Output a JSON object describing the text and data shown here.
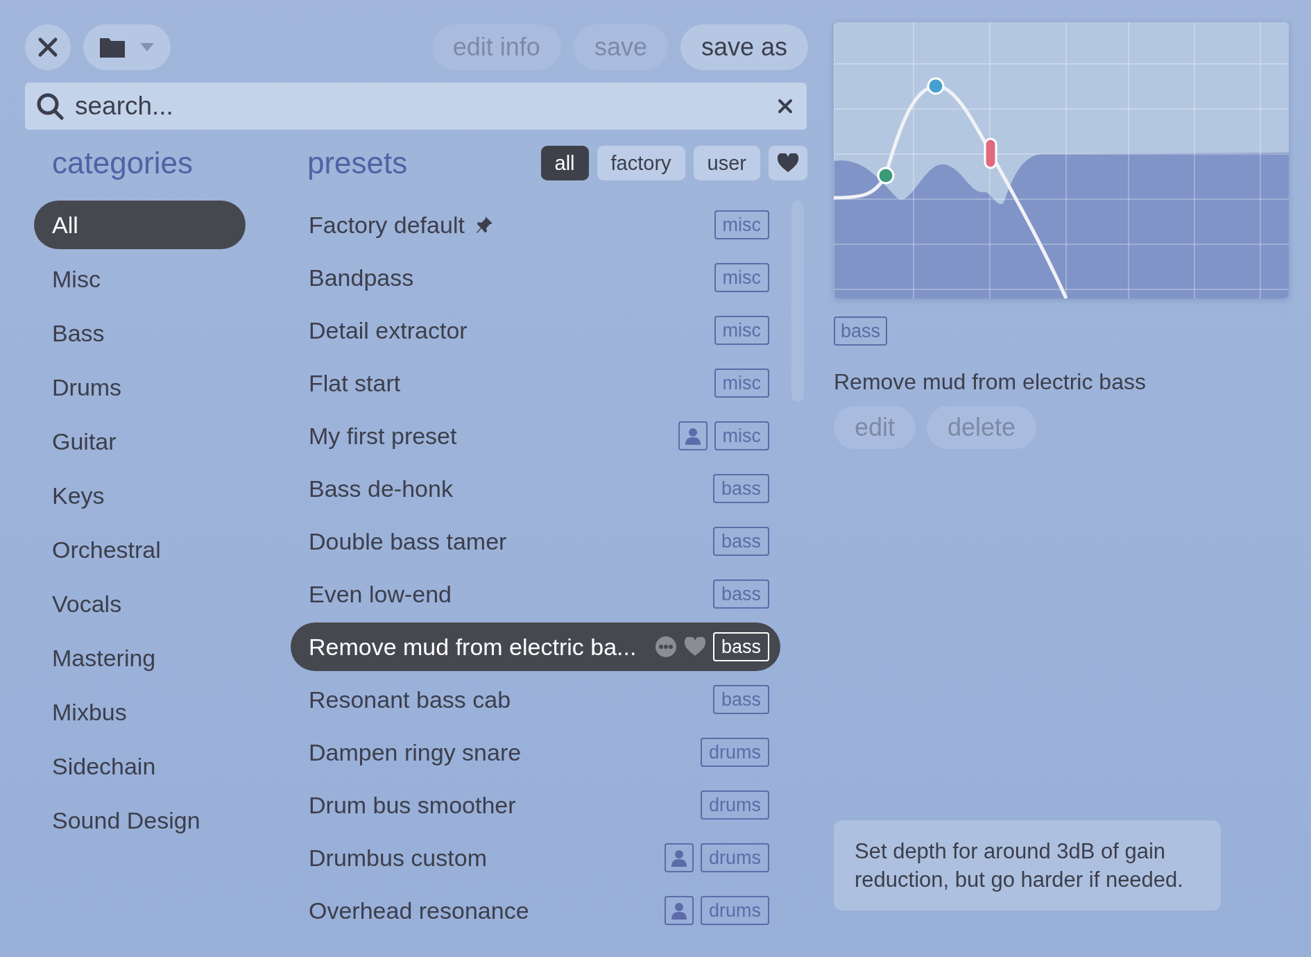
{
  "toolbar": {
    "buttons": [
      {
        "label": "edit info",
        "disabled": true
      },
      {
        "label": "save",
        "disabled": true
      },
      {
        "label": "save as",
        "disabled": false
      }
    ]
  },
  "search": {
    "placeholder": "search..."
  },
  "categories": {
    "title": "categories",
    "items": [
      {
        "label": "All",
        "selected": true
      },
      {
        "label": "Misc",
        "selected": false
      },
      {
        "label": "Bass",
        "selected": false
      },
      {
        "label": "Drums",
        "selected": false
      },
      {
        "label": "Guitar",
        "selected": false
      },
      {
        "label": "Keys",
        "selected": false
      },
      {
        "label": "Orchestral",
        "selected": false
      },
      {
        "label": "Vocals",
        "selected": false
      },
      {
        "label": "Mastering",
        "selected": false
      },
      {
        "label": "Mixbus",
        "selected": false
      },
      {
        "label": "Sidechain",
        "selected": false
      },
      {
        "label": "Sound Design",
        "selected": false
      }
    ]
  },
  "presets": {
    "title": "presets",
    "filters": [
      {
        "label": "all",
        "selected": true
      },
      {
        "label": "factory",
        "selected": false
      },
      {
        "label": "user",
        "selected": false
      },
      {
        "kind": "favorites",
        "selected": false
      }
    ],
    "items": [
      {
        "name": "Factory default",
        "tag": "misc",
        "pinned": true,
        "user": false,
        "selected": false
      },
      {
        "name": "Bandpass",
        "tag": "misc",
        "pinned": false,
        "user": false,
        "selected": false
      },
      {
        "name": "Detail extractor",
        "tag": "misc",
        "pinned": false,
        "user": false,
        "selected": false
      },
      {
        "name": "Flat start",
        "tag": "misc",
        "pinned": false,
        "user": false,
        "selected": false
      },
      {
        "name": "My first preset",
        "tag": "misc",
        "pinned": false,
        "user": true,
        "selected": false
      },
      {
        "name": "Bass de-honk",
        "tag": "bass",
        "pinned": false,
        "user": false,
        "selected": false
      },
      {
        "name": "Double bass tamer",
        "tag": "bass",
        "pinned": false,
        "user": false,
        "selected": false
      },
      {
        "name": "Even low-end",
        "tag": "bass",
        "pinned": false,
        "user": false,
        "selected": false
      },
      {
        "name": "Remove mud from electric ba...",
        "tag": "bass",
        "pinned": false,
        "user": false,
        "selected": true
      },
      {
        "name": "Resonant bass cab",
        "tag": "bass",
        "pinned": false,
        "user": false,
        "selected": false
      },
      {
        "name": "Dampen ringy snare",
        "tag": "drums",
        "pinned": false,
        "user": false,
        "selected": false
      },
      {
        "name": "Drum bus smoother",
        "tag": "drums",
        "pinned": false,
        "user": false,
        "selected": false
      },
      {
        "name": "Drumbus custom",
        "tag": "drums",
        "pinned": false,
        "user": true,
        "selected": false
      },
      {
        "name": "Overhead resonance",
        "tag": "drums",
        "pinned": false,
        "user": true,
        "selected": false
      }
    ]
  },
  "detail": {
    "tag": "bass",
    "description": "Remove mud from electric bass",
    "buttons": [
      {
        "label": "edit",
        "disabled": true
      },
      {
        "label": "delete",
        "disabled": true
      }
    ],
    "note": "Set depth for around 3dB of gain reduction, but go harder if needed."
  }
}
